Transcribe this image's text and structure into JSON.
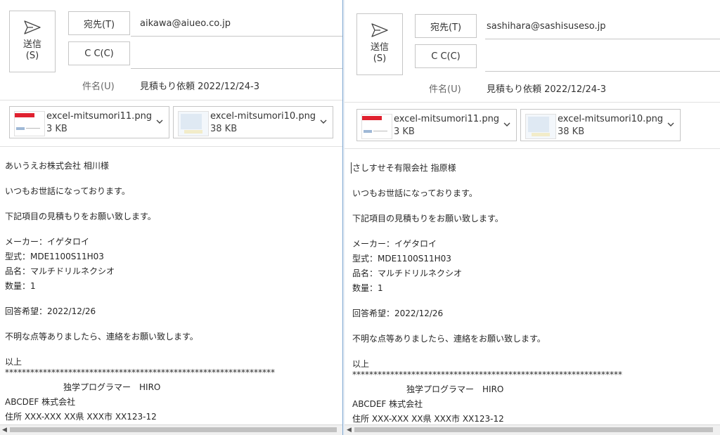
{
  "panes": [
    {
      "send_label_1": "送信",
      "send_label_2": "(S)",
      "to_label": "宛先(T)",
      "to_value": "aikawa@aiueo.co.jp",
      "cc_label": "C C(C)",
      "cc_value": "",
      "subject_label": "件名(U)",
      "subject_value": "見積もり依頼 2022/12/24-3",
      "attachments": [
        {
          "name": "excel-mitsumori11.png",
          "size": "3 KB"
        },
        {
          "name": "excel-mitsumori10.png",
          "size": "38 KB"
        }
      ],
      "body": {
        "greeting": "あいうえお株式会社 相川様",
        "line1": "いつもお世話になっております。",
        "line2": "下記項目の見積もりをお願い致します。",
        "maker": "メーカー：イゲタロイ",
        "model": "型式：MDE1100S11H03",
        "product": "品名：マルチドリルネクシオ",
        "qty": "数量：1",
        "reply": "回答希望：2022/12/26",
        "closing": "不明な点等ありましたら、連絡をお願い致します。",
        "end": "以上",
        "stars": "****************************************************************",
        "sig_name": "独学プログラマー　HIRO",
        "sig_company": "ABCDEF 株式会社",
        "sig_address": "住所 XXX-XXX XX県 XXX市 XX123-12"
      }
    },
    {
      "send_label_1": "送信",
      "send_label_2": "(S)",
      "to_label": "宛先(T)",
      "to_value": "sashihara@sashisuseso.jp",
      "cc_label": "C C(C)",
      "cc_value": "",
      "subject_label": "件名(U)",
      "subject_value": "見積もり依頼 2022/12/24-3",
      "attachments": [
        {
          "name": "excel-mitsumori11.png",
          "size": "3 KB"
        },
        {
          "name": "excel-mitsumori10.png",
          "size": "38 KB"
        }
      ],
      "body": {
        "greeting": "さしすせそ有限会社 指原様",
        "line1": "いつもお世話になっております。",
        "line2": "下記項目の見積もりをお願い致します。",
        "maker": "メーカー：イゲタロイ",
        "model": "型式：MDE1100S11H03",
        "product": "品名：マルチドリルネクシオ",
        "qty": "数量：1",
        "reply": "回答希望：2022/12/26",
        "closing": "不明な点等ありましたら、連絡をお願い致します。",
        "end": "以上",
        "stars": "****************************************************************",
        "sig_name": "独学プログラマー　HIRO",
        "sig_company": "ABCDEF 株式会社",
        "sig_address": "住所 XXX-XXX XX県 XXX市 XX123-12"
      }
    }
  ],
  "icons": {
    "send": "paper-plane-icon",
    "dropdown": "chevron-down-icon",
    "scroll_left": "scroll-left-arrow-icon"
  }
}
